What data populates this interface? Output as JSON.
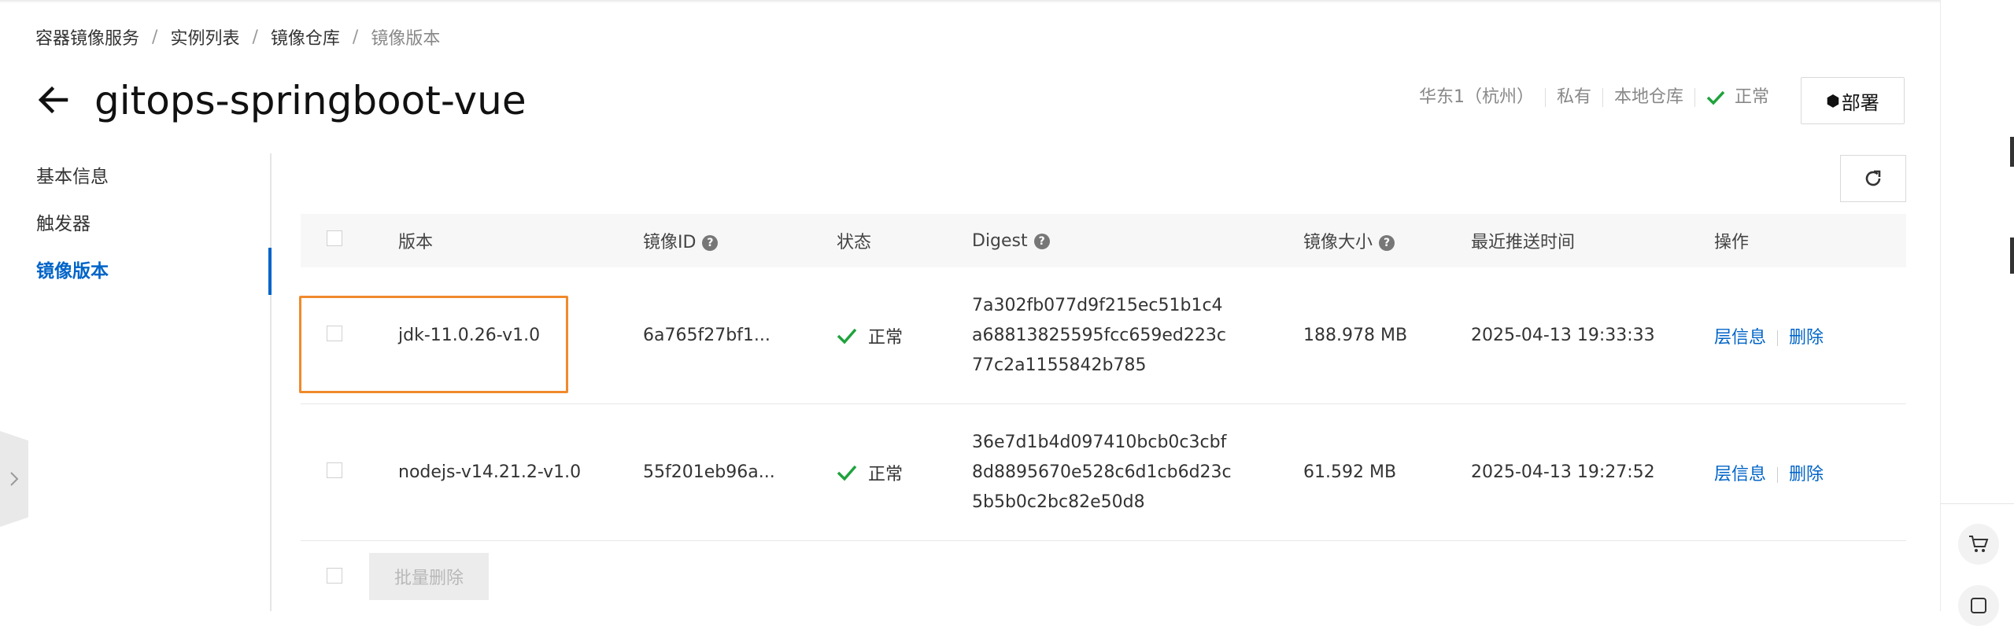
{
  "breadcrumb": {
    "items": [
      "容器镜像服务",
      "实例列表",
      "镜像仓库"
    ],
    "current": "镜像版本",
    "separator": "/"
  },
  "header": {
    "title": "gitops-springboot-vue",
    "region": "华东1（杭州）",
    "visibility": "私有",
    "repo_source": "本地仓库",
    "status": "正常",
    "deploy_label": "部署"
  },
  "sidebar": {
    "items": [
      {
        "label": "基本信息",
        "active": false
      },
      {
        "label": "触发器",
        "active": false
      },
      {
        "label": "镜像版本",
        "active": true
      }
    ]
  },
  "table": {
    "headers": {
      "version": "版本",
      "image_id": "镜像ID",
      "status": "状态",
      "digest": "Digest",
      "size": "镜像大小",
      "last_push": "最近推送时间",
      "ops": "操作"
    },
    "rows": [
      {
        "version": "jdk-11.0.26-v1.0",
        "image_id": "6a765f27bf1...",
        "status": "正常",
        "digest": "7a302fb077d9f215ec51b1c4a68813825595fcc659ed223c77c2a1155842b785",
        "size": "188.978 MB",
        "last_push": "2025-04-13 19:33:33",
        "op_layer": "层信息",
        "op_delete": "删除"
      },
      {
        "version": "nodejs-v14.21.2-v1.0",
        "image_id": "55f201eb96a...",
        "status": "正常",
        "digest": "36e7d1b4d097410bcb0c3cbf8d8895670e528c6d1cb6d23c5b5b0c2bc82e50d8",
        "size": "61.592 MB",
        "last_push": "2025-04-13 19:27:52",
        "op_layer": "层信息",
        "op_delete": "删除"
      }
    ]
  },
  "footer": {
    "batch_delete_label": "批量删除"
  },
  "colors": {
    "accent": "#0064c8",
    "success": "#1fa33d",
    "highlight": "#f08a2c"
  },
  "icons": {
    "back": "arrow-left-icon",
    "status": "check-icon",
    "deploy": "cube-icon",
    "refresh": "refresh-icon",
    "help": "question-circle-icon",
    "cart": "cart-icon",
    "edge": "chevron-right-icon"
  }
}
